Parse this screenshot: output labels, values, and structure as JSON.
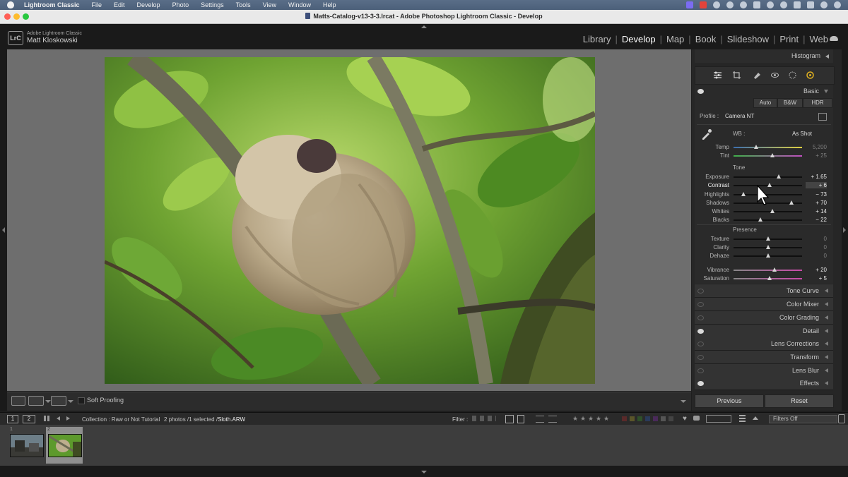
{
  "menubar": {
    "app": "Lightroom Classic",
    "items": [
      "File",
      "Edit",
      "Develop",
      "Photo",
      "Settings",
      "Tools",
      "View",
      "Window",
      "Help"
    ]
  },
  "window": {
    "title": "Matts-Catalog-v13-3-3.lrcat - Adobe Photoshop Lightroom Classic - Develop"
  },
  "identity": {
    "logo": "LrC",
    "line1": "Adobe Lightroom Classic",
    "line2": "Matt Kloskowski"
  },
  "modules": [
    "Library",
    "Develop",
    "Map",
    "Book",
    "Slideshow",
    "Print",
    "Web"
  ],
  "active_module": "Develop",
  "toolbar": {
    "soft_proofing": "Soft Proofing"
  },
  "panel": {
    "histogram": "Histogram",
    "basic": "Basic",
    "treatment": [
      "Auto",
      "B&W",
      "HDR"
    ],
    "profile_label": "Profile :",
    "profile_value": "Camera NT",
    "wb_label": "WB :",
    "wb_value": "As Shot",
    "tone_title": "Tone",
    "presence_title": "Presence",
    "sliders": [
      {
        "label": "Temp",
        "value": "5,200",
        "pos": 0.33,
        "dim": true
      },
      {
        "label": "Tint",
        "value": "+ 25",
        "pos": 0.57,
        "dim": true
      },
      {
        "label": "Exposure",
        "value": "+ 1.65",
        "pos": 0.66
      },
      {
        "label": "Contrast",
        "value": "+ 6",
        "pos": 0.53
      },
      {
        "label": "Highlights",
        "value": "− 73",
        "pos": 0.14
      },
      {
        "label": "Shadows",
        "value": "+ 70",
        "pos": 0.85
      },
      {
        "label": "Whites",
        "value": "+ 14",
        "pos": 0.57
      },
      {
        "label": "Blacks",
        "value": "− 22",
        "pos": 0.39
      },
      {
        "label": "Texture",
        "value": "0",
        "pos": 0.5,
        "dim": true
      },
      {
        "label": "Clarity",
        "value": "0",
        "pos": 0.5,
        "dim": true
      },
      {
        "label": "Dehaze",
        "value": "0",
        "pos": 0.5,
        "dim": true
      },
      {
        "label": "Vibrance",
        "value": "+ 20",
        "pos": 0.6
      },
      {
        "label": "Saturation",
        "value": "+ 5",
        "pos": 0.53
      }
    ],
    "sections": [
      {
        "label": "Tone Curve",
        "eye_on": false
      },
      {
        "label": "Color Mixer",
        "eye_on": false
      },
      {
        "label": "Color Grading",
        "eye_on": false
      },
      {
        "label": "Detail",
        "eye_on": true
      },
      {
        "label": "Lens Corrections",
        "eye_on": false
      },
      {
        "label": "Transform",
        "eye_on": false
      },
      {
        "label": "Lens Blur",
        "eye_on": false
      },
      {
        "label": "Effects",
        "eye_on": true
      }
    ],
    "previous": "Previous",
    "reset": "Reset"
  },
  "filmbar": {
    "page1": "1",
    "page2": "2",
    "collection": "Collection : Raw or Not Tutorial",
    "count_prefix": "2 photos /1 selected /",
    "filename": "Sloth.ARW",
    "filter_label": "Filter :",
    "filters_value": "Filters Off"
  },
  "filmstrip": [
    {
      "num": "1"
    },
    {
      "num": "2"
    }
  ]
}
